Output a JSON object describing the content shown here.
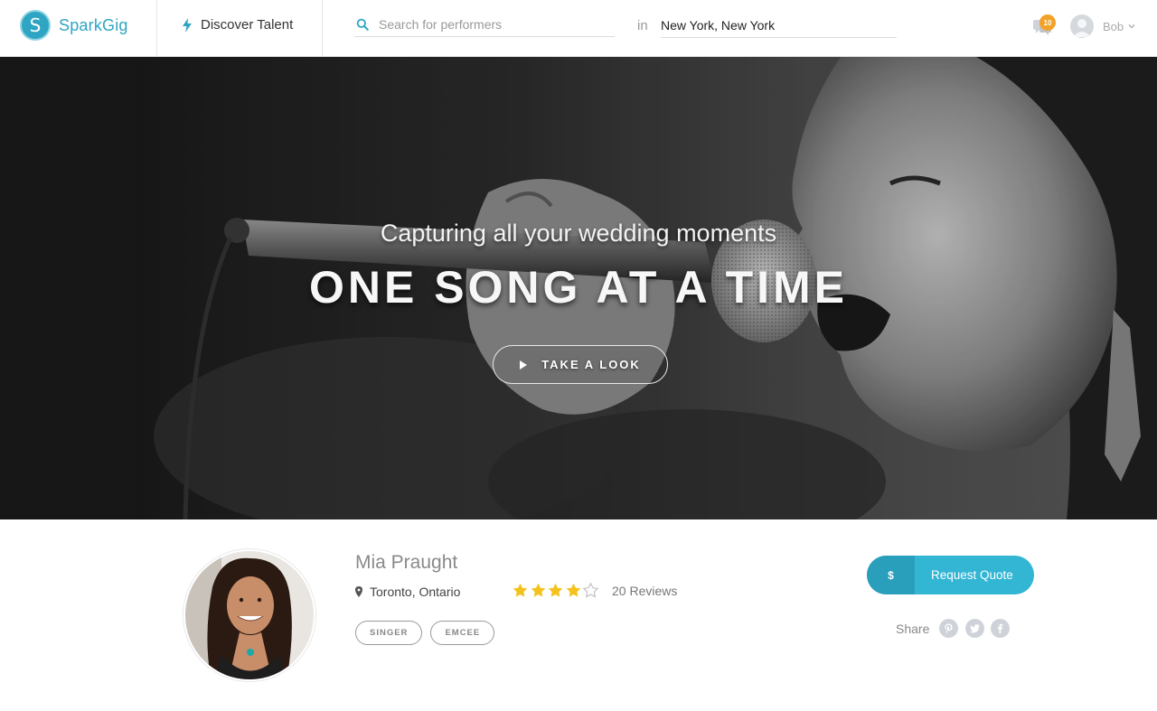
{
  "brand": {
    "name": "SparkGig",
    "logo_letter": "S",
    "accent_color": "#2ea5c2"
  },
  "nav": {
    "discover_label": "Discover Talent"
  },
  "search": {
    "placeholder": "Search for performers",
    "value": "",
    "in_label": "in",
    "location_value": "New York, New York"
  },
  "notifications": {
    "count": "10"
  },
  "user": {
    "name": "Bob"
  },
  "hero": {
    "subtitle": "Capturing all your wedding moments",
    "title": "ONE SONG AT A TIME",
    "cta_label": "TAKE A LOOK"
  },
  "profile": {
    "name": "Mia Praught",
    "location": "Toronto, Ontario",
    "rating": 4,
    "rating_max": 5,
    "reviews_label": "20 Reviews",
    "tags": [
      "SINGER",
      "EMCEE"
    ],
    "quote_icon": "$",
    "quote_label": "Request Quote",
    "share_label": "Share",
    "share_icons": [
      "pinterest-icon",
      "twitter-icon",
      "facebook-icon"
    ],
    "star_color": "#f4c21d"
  }
}
